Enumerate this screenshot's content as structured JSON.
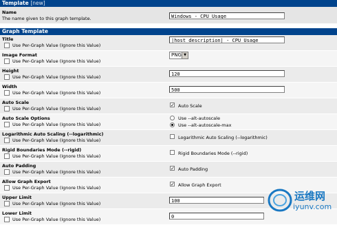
{
  "template_section": {
    "title": "Template",
    "new_tag": "[new]",
    "name_label": "Name",
    "name_desc": "The name given to this graph template.",
    "name_value": "Windows - CPU Usage"
  },
  "graph_section": {
    "title": "Graph Template"
  },
  "per_graph_text": "Use Per-Graph Value (Ignore this Value)",
  "rows": {
    "title": {
      "label": "Title",
      "value": "|host_description| - CPU Usage"
    },
    "image_format": {
      "label": "Image Format",
      "value": "PNG"
    },
    "height": {
      "label": "Height",
      "value": "120"
    },
    "width": {
      "label": "Width",
      "value": "500"
    },
    "auto_scale": {
      "label": "Auto Scale",
      "option": "Auto Scale",
      "checked": true
    },
    "auto_scale_options": {
      "label": "Auto Scale Options",
      "opt1": "Use --alt-autoscale",
      "opt2": "Use --alt-autoscale-max",
      "selected": "opt2"
    },
    "log_scaling": {
      "label": "Logarithmic Auto Scaling (--logarithmic)",
      "option": "Logarithmic Auto Scaling (--logarithmic)",
      "checked": false
    },
    "rigid": {
      "label": "Rigid Boundaries Mode (--rigid)",
      "option": "Rigid Boundaries Mode (--rigid)",
      "checked": false
    },
    "auto_padding": {
      "label": "Auto Padding",
      "option": "Auto Padding",
      "checked": true
    },
    "allow_export": {
      "label": "Allow Graph Export",
      "option": "Allow Graph Export",
      "checked": true
    },
    "upper_limit": {
      "label": "Upper Limit",
      "value": "100"
    },
    "lower_limit": {
      "label": "Lower Limit",
      "value": "0"
    }
  },
  "watermark": {
    "line1": "运维网",
    "line2": "iyunv.com"
  },
  "colors": {
    "header": "#00438c",
    "row_a": "#ebebeb",
    "row_b": "#f5f5f5",
    "watermark": "#1a78c2"
  }
}
